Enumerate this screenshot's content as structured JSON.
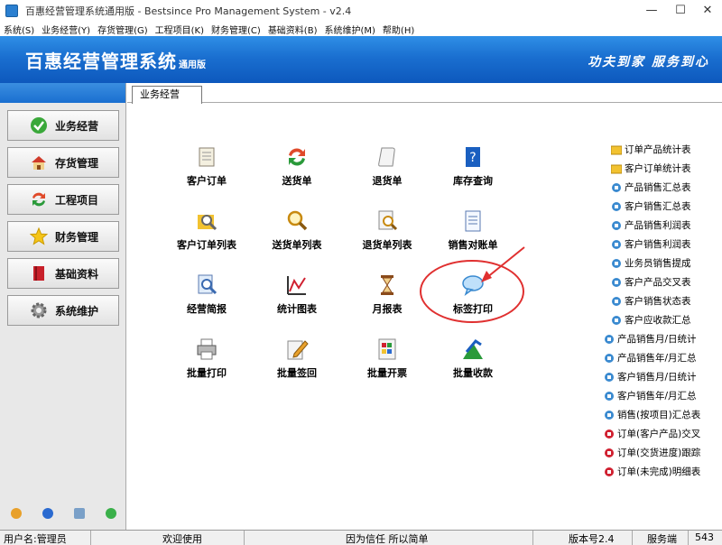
{
  "window": {
    "title": "百惠经营管理系统通用版 - Bestsince Pro Management System - v2.4",
    "minimize": "—",
    "maximize": "☐",
    "close": "✕"
  },
  "menu": [
    "系统(S)",
    "业务经营(Y)",
    "存货管理(G)",
    "工程项目(K)",
    "财务管理(C)",
    "基础资料(B)",
    "系统维护(M)",
    "帮助(H)"
  ],
  "banner": {
    "title": "百惠经营管理系统",
    "edition": "通用版",
    "slogan": "功夫到家 服务到心"
  },
  "nav": [
    {
      "label": "业务经营",
      "icon": "check-icon"
    },
    {
      "label": "存货管理",
      "icon": "house-icon"
    },
    {
      "label": "工程项目",
      "icon": "cycle-arrows-icon"
    },
    {
      "label": "财务管理",
      "icon": "star-icon"
    },
    {
      "label": "基础资料",
      "icon": "book-icon"
    },
    {
      "label": "系统维护",
      "icon": "gear-icon"
    }
  ],
  "tab": "业务经营",
  "grid": [
    {
      "label": "客户订单",
      "icon": "scroll-icon"
    },
    {
      "label": "送货单",
      "icon": "cycle-arrows-icon"
    },
    {
      "label": "退货单",
      "icon": "scroll-icon"
    },
    {
      "label": "库存查询",
      "icon": "book-help-icon"
    },
    {
      "label": "客户订单列表",
      "icon": "folder-search-icon"
    },
    {
      "label": "送货单列表",
      "icon": "magnifier-icon"
    },
    {
      "label": "退货单列表",
      "icon": "doc-search-icon"
    },
    {
      "label": "销售对账单",
      "icon": "document-icon"
    },
    {
      "label": "经营简报",
      "icon": "report-search-icon"
    },
    {
      "label": "统计图表",
      "icon": "line-chart-icon"
    },
    {
      "label": "月报表",
      "icon": "hourglass-icon"
    },
    {
      "label": "标签打印",
      "icon": "speech-bubble-icon"
    },
    {
      "label": "批量打印",
      "icon": "printer-icon"
    },
    {
      "label": "批量签回",
      "icon": "pencil-doc-icon"
    },
    {
      "label": "批量开票",
      "icon": "invoice-icon"
    },
    {
      "label": "批量收款",
      "icon": "up-arrow-icon"
    }
  ],
  "reports": [
    {
      "label": "订单产品统计表",
      "icon": "folder-icon"
    },
    {
      "label": "客户订单统计表",
      "icon": "folder-icon"
    },
    {
      "label": "产品销售汇总表",
      "icon": "report-icon"
    },
    {
      "label": "客户销售汇总表",
      "icon": "report-icon"
    },
    {
      "label": "产品销售利润表",
      "icon": "report-icon"
    },
    {
      "label": "客户销售利润表",
      "icon": "report-icon"
    },
    {
      "label": "业务员销售提成",
      "icon": "report-icon"
    },
    {
      "label": "客户产品交叉表",
      "icon": "report-icon"
    },
    {
      "label": "客户销售状态表",
      "icon": "report-icon"
    },
    {
      "label": "客户应收款汇总",
      "icon": "report-icon"
    },
    {
      "label": "产品销售月/日统计",
      "icon": "report-icon"
    },
    {
      "label": "产品销售年/月汇总",
      "icon": "report-icon"
    },
    {
      "label": "客户销售月/日统计",
      "icon": "report-icon"
    },
    {
      "label": "客户销售年/月汇总",
      "icon": "report-icon"
    },
    {
      "label": "销售(按项目)汇总表",
      "icon": "report-icon"
    },
    {
      "label": "订单(客户产品)交叉",
      "icon": "report-red-icon"
    },
    {
      "label": "订单(交货进度)跟踪",
      "icon": "report-red-icon"
    },
    {
      "label": "订单(未完成)明细表",
      "icon": "report-red-icon"
    }
  ],
  "status": {
    "user": "用户名:管理员",
    "welcome": "欢迎使用",
    "motto": "因为信任 所以简单",
    "version": "版本号2.4",
    "server": "服务端",
    "number": "543"
  },
  "colors": {
    "banner": "#1a6fd0",
    "annotation": "#e03030"
  }
}
